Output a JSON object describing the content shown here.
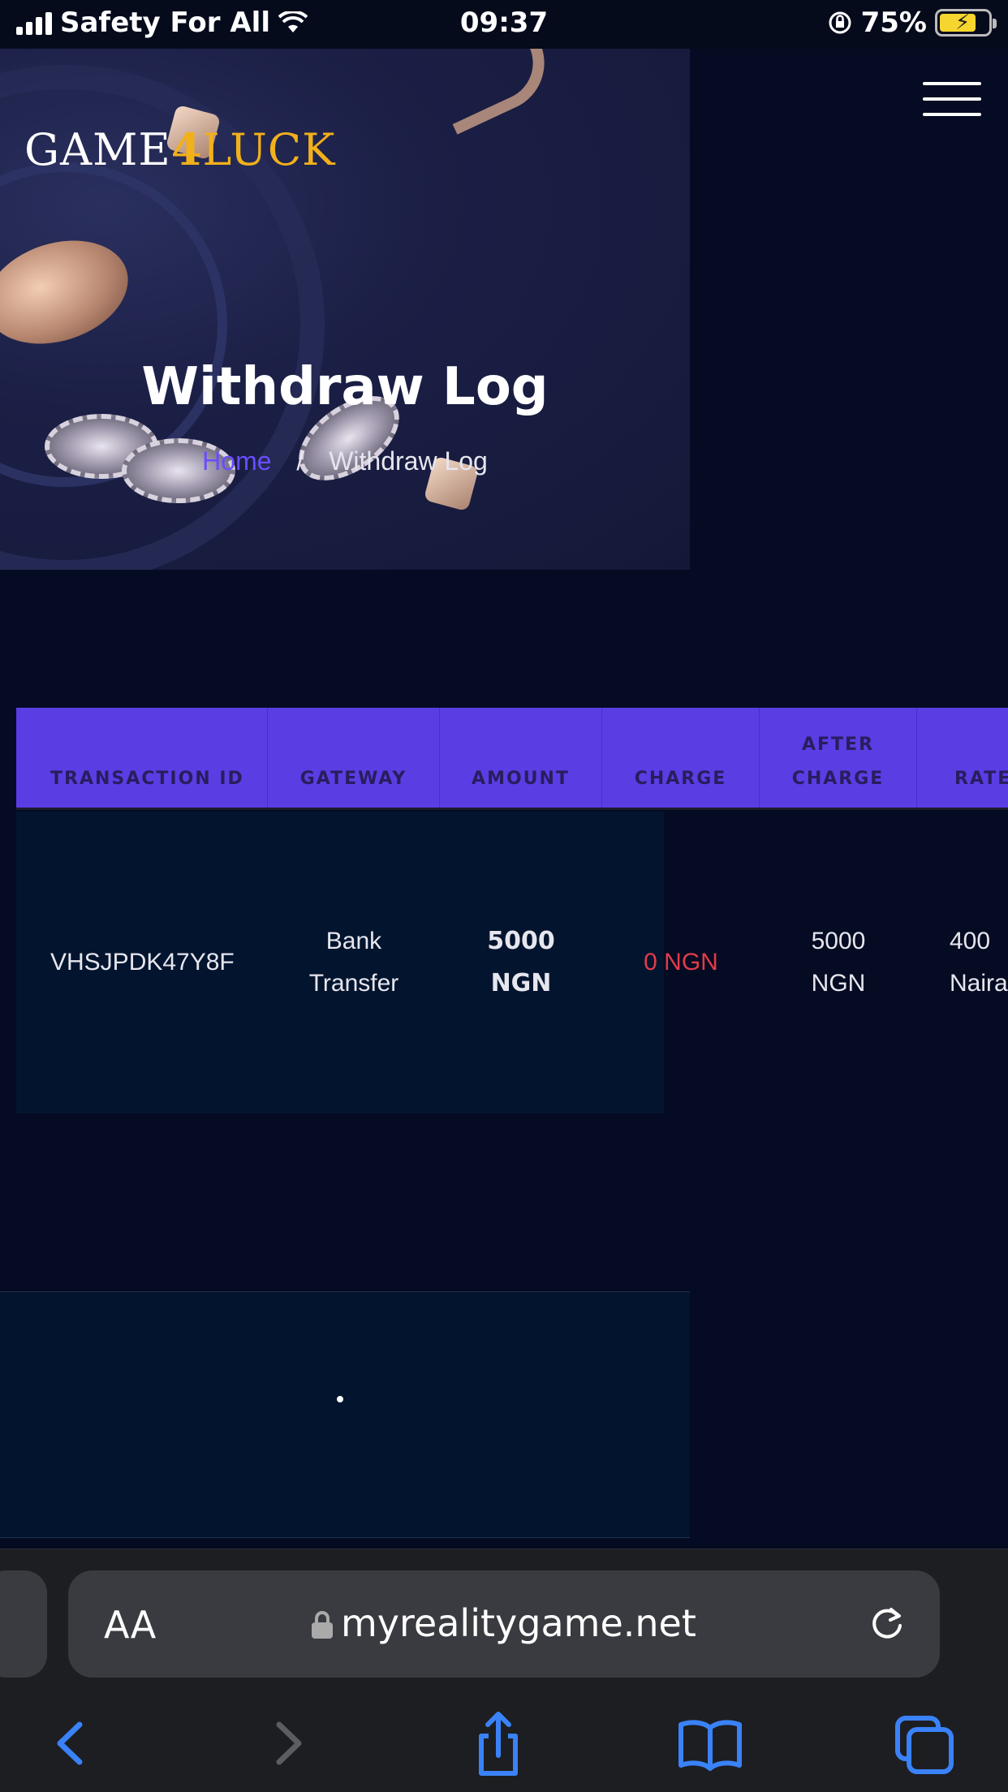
{
  "status_bar": {
    "carrier": "Safety For All",
    "time": "09:37",
    "battery_percent": "75%",
    "battery_level": 0.75
  },
  "header": {
    "logo_prefix": "GAME",
    "logo_number": "4",
    "logo_suffix": "LUCK",
    "menu_icon": "hamburger-icon"
  },
  "hero": {
    "title": "Withdraw Log",
    "breadcrumb": {
      "home": "Home",
      "separator": "/",
      "current": "Withdraw Log"
    }
  },
  "table": {
    "headers": {
      "transaction_id": "TRANSACTION ID",
      "gateway": "GATEWAY",
      "amount": "AMOUNT",
      "charge": "CHARGE",
      "after_charge": "AFTER CHARGE",
      "rate": "RATE"
    },
    "rows": [
      {
        "transaction_id": "VHSJPDK47Y8F",
        "gateway": "Bank Transfer",
        "amount": "5000 NGN",
        "charge": "0 NGN",
        "after_charge": "5000 NGN",
        "rate": "400 Naira"
      }
    ]
  },
  "browser": {
    "text_size_label": "AA",
    "url": "myrealitygame.net"
  },
  "colors": {
    "accent_purple": "#5b3de4",
    "breadcrumb_link": "#6a4dff",
    "charge_red": "#e23b4a",
    "logo_gold": "#f2b01b",
    "ios_blue": "#3a82f7"
  }
}
